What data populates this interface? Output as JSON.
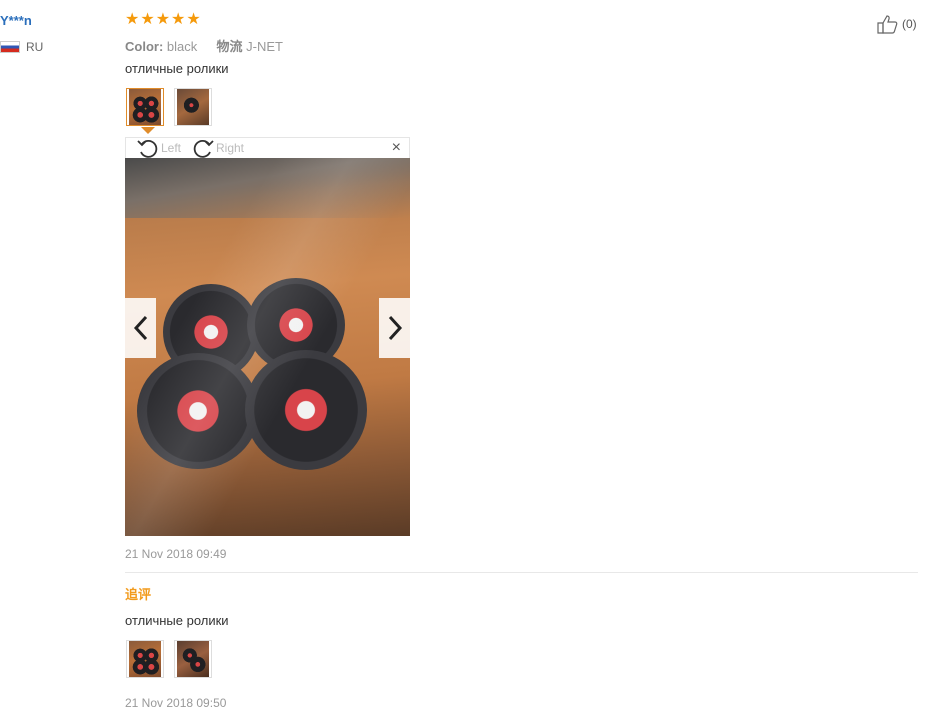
{
  "review": {
    "user_name": "Y***n",
    "country_code": "RU",
    "rating_stars": 5,
    "color_label": "Color:",
    "color_value": "black",
    "shipping_label": "物流",
    "shipping_value": "J-NET",
    "text": "отличные ролики",
    "likes": "(0)",
    "date": "21 Nov 2018 09:49",
    "viewer": {
      "rotate_left_label": "Left",
      "rotate_right_label": "Right",
      "close_symbol": "×"
    }
  },
  "followup": {
    "label": "追评",
    "text": "отличные ролики",
    "date": "21 Nov 2018 09:50"
  },
  "colors": {
    "star": "#f59a0c",
    "username": "#2a6ebb",
    "followup_label": "#f29b1d",
    "active_thumb_border": "#e08c2a"
  },
  "icons": {
    "star": "star-icon",
    "flag": "russia-flag-icon",
    "like": "thumbs-up-icon",
    "rotate_left": "rotate-left-icon",
    "rotate_right": "rotate-right-icon",
    "close": "close-icon",
    "prev": "chevron-left-icon",
    "next": "chevron-right-icon"
  }
}
